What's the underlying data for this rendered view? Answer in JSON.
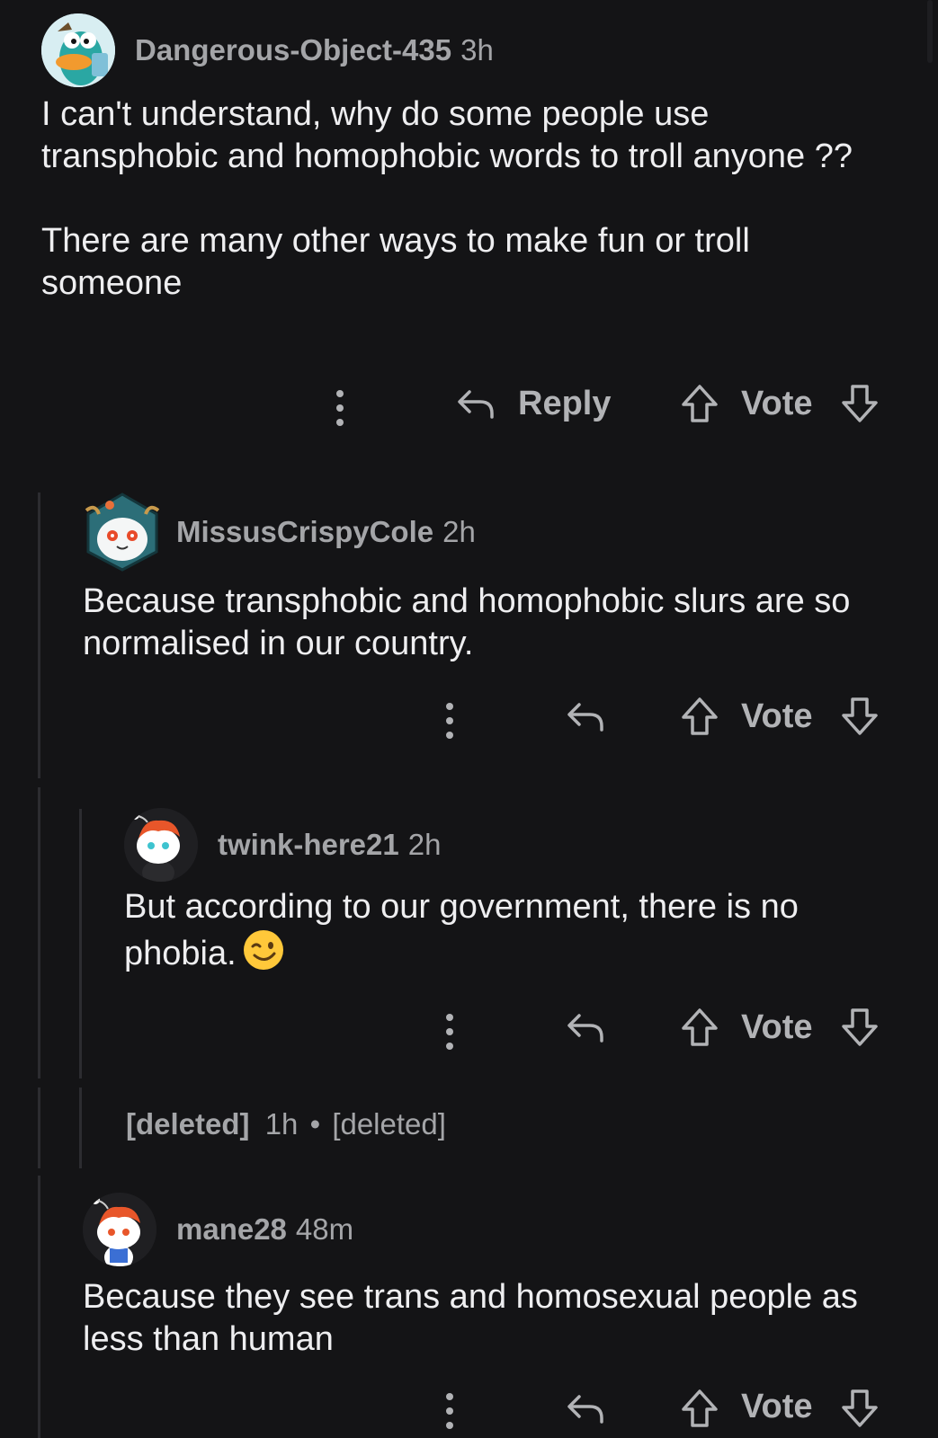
{
  "comments": [
    {
      "author": "Dangerous-Object-435",
      "age": "3h",
      "avatar": "perry-platypus-avatar",
      "paragraphs": [
        "I can't understand, why do some people use transphobic and homophobic words to troll anyone ??",
        "There are many other ways to make fun or troll someone"
      ],
      "reply_label": "Reply",
      "vote_label": "Vote"
    },
    {
      "author": "MissusCrispyCole",
      "age": "2h",
      "avatar": "snow-creature-hexagon-avatar",
      "paragraphs": [
        "Because transphobic and homophobic slurs are so normalised in our country."
      ],
      "vote_label": "Vote"
    },
    {
      "author": "twink-here21",
      "age": "2h",
      "avatar": "snoo-red-hair-avatar",
      "paragraphs": [
        "But according to our government, there is no phobia."
      ],
      "emoji": "winking-face-emoji",
      "vote_label": "Vote"
    },
    {
      "author": "[deleted]",
      "age": "1h",
      "separator": "•",
      "body": "[deleted]"
    },
    {
      "author": "mane28",
      "age": "48m",
      "avatar": "snoo-red-hair-avatar",
      "paragraphs": [
        "Because they see trans and homosexual people as less than human"
      ],
      "vote_label": "Vote"
    }
  ],
  "colors": {
    "background": "#141416",
    "meta_text": "#a4a5a8",
    "body_text": "#eeeef0",
    "thread_line": "#2c2c30"
  }
}
